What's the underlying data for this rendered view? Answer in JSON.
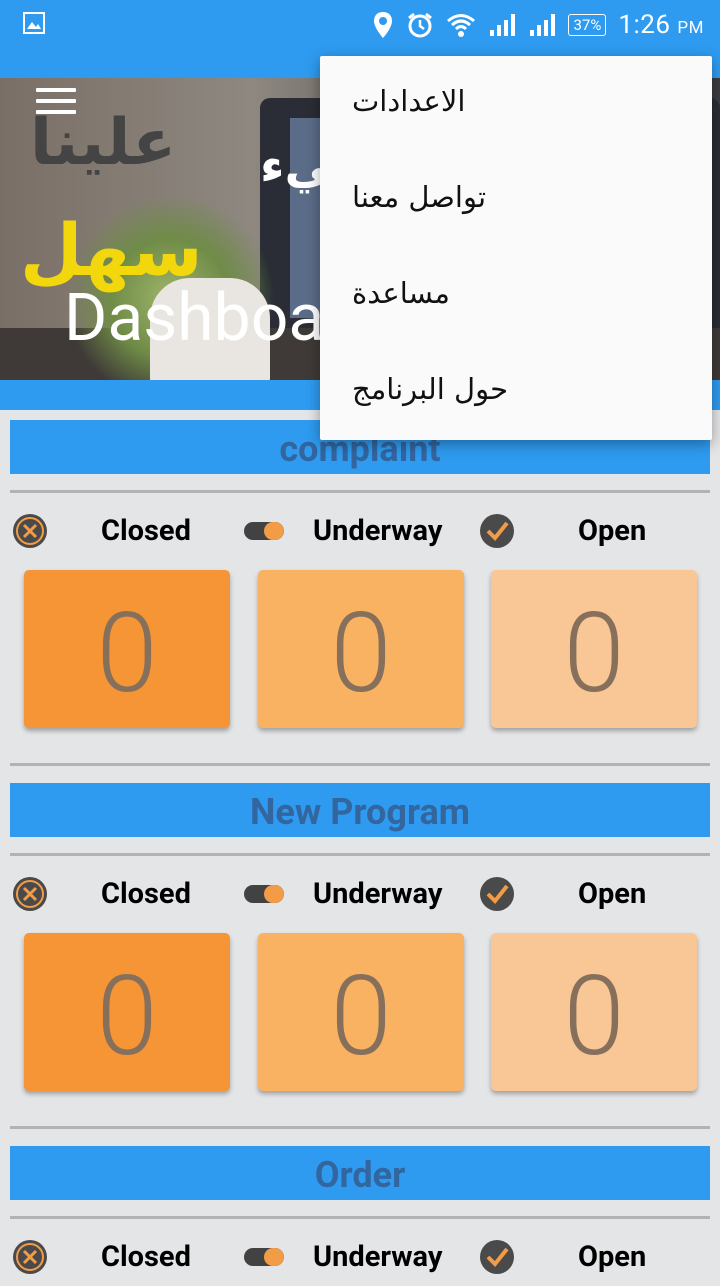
{
  "status_bar": {
    "time": "1:26",
    "ampm": "PM",
    "battery": "37%"
  },
  "hero": {
    "title": "Dashboa",
    "overlay_text_1": "علينا",
    "overlay_text_2": "كل شيء",
    "overlay_text_3": "سهل"
  },
  "menu": {
    "items": [
      {
        "label": "الاعدادات"
      },
      {
        "label": "تواصل معنا"
      },
      {
        "label": "مساعدة"
      },
      {
        "label": "حول البرنامج"
      }
    ]
  },
  "sections": [
    {
      "title": "complaint",
      "statuses": {
        "closed": "Closed",
        "underway": "Underway",
        "open": "Open"
      },
      "counts": {
        "closed": "0",
        "underway": "0",
        "open": "0"
      }
    },
    {
      "title": "New Program",
      "statuses": {
        "closed": "Closed",
        "underway": "Underway",
        "open": "Open"
      },
      "counts": {
        "closed": "0",
        "underway": "0",
        "open": "0"
      }
    },
    {
      "title": "Order",
      "statuses": {
        "closed": "Closed",
        "underway": "Underway",
        "open": "Open"
      }
    }
  ],
  "colors": {
    "primary": "#2e9bf0",
    "closed_card": "#f69535",
    "underway_card": "#f9b162",
    "open_card": "#f9c796",
    "section_title": "#33659e"
  },
  "icons": {
    "closed": "close-circle-icon",
    "underway": "toggle-icon",
    "open": "check-circle-icon",
    "menu": "hamburger-menu-icon"
  }
}
